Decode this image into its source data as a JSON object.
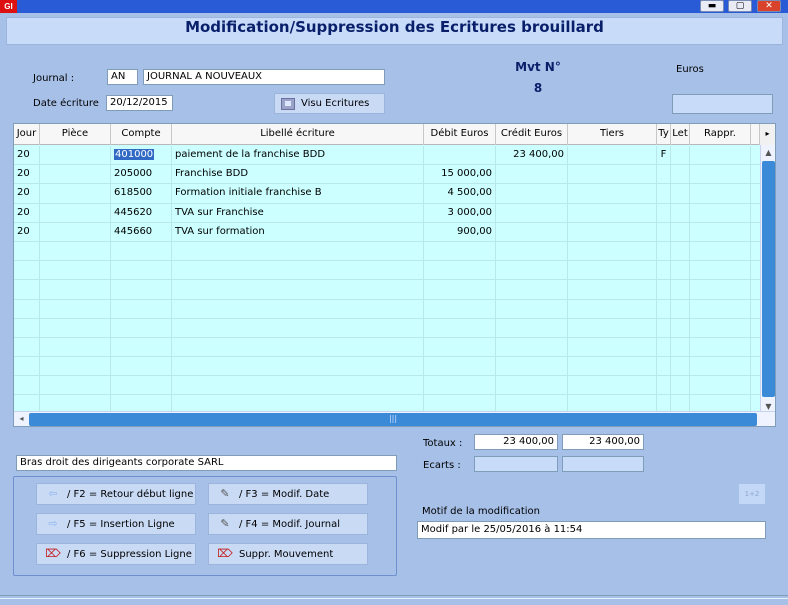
{
  "window": {
    "app_icon_text": "GI",
    "minimize_glyph": "▬",
    "maximize_glyph": "▢",
    "close_glyph": "✕"
  },
  "header": {
    "title": "Modification/Suppression des Ecritures brouillard"
  },
  "form": {
    "journal_label": "Journal :",
    "journal_code": "AN",
    "journal_name": "JOURNAL A NOUVEAUX",
    "date_label": "Date écriture",
    "date_value": "20/12/2015",
    "visu_button": "Visu Ecritures",
    "mvt_label": "Mvt N°",
    "mvt_number": "8",
    "currency_label": "Euros"
  },
  "grid": {
    "columns": [
      "Jour",
      "Pièce",
      "Compte",
      "Libellé écriture",
      "Débit Euros",
      "Crédit Euros",
      "Tiers",
      "Ty",
      "Let",
      "Rappr."
    ],
    "rows": [
      [
        "20",
        "",
        "401000",
        "paiement de la franchise BDD",
        "",
        "23 400,00",
        "",
        "F",
        "",
        ""
      ],
      [
        "20",
        "",
        "205000",
        "Franchise BDD",
        "15 000,00",
        "",
        "",
        "",
        "",
        ""
      ],
      [
        "20",
        "",
        "618500",
        "Formation initiale franchise B",
        "4 500,00",
        "",
        "",
        "",
        "",
        ""
      ],
      [
        "20",
        "",
        "445620",
        "TVA sur Franchise",
        "3 000,00",
        "",
        "",
        "",
        "",
        ""
      ],
      [
        "20",
        "",
        "445660",
        "TVA sur formation",
        "900,00",
        "",
        "",
        "",
        "",
        ""
      ]
    ],
    "empty_rows": 9,
    "scroll_right_glyph": "▸",
    "scroll_up_glyph": "▲",
    "scroll_down_glyph": "▼",
    "scroll_left_glyph": "◂",
    "hscroll_grip": "|||"
  },
  "totals": {
    "totaux_label": "Totaux :",
    "total_debit": "23 400,00",
    "total_credit": "23 400,00",
    "ecarts_label": "Ecarts :",
    "ecart_debit": "",
    "ecart_credit": ""
  },
  "account_desc": "Bras droit des dirigeants corporate SARL",
  "buttons": {
    "f2": "/ F2 = Retour début ligne",
    "f3": "/ F3 = Modif. Date",
    "f5": "/ F5 = Insertion Ligne",
    "f4": "/ F4 = Modif. Journal",
    "f6": "/ F6 = Suppression Ligne",
    "suppr": "Suppr. Mouvement",
    "plus_minus": "1+2"
  },
  "motif": {
    "label": "Motif de la modification",
    "value": "Modif par  le 25/05/2016 à 11:54"
  },
  "icons": {
    "arrow_left": "⇦",
    "arrow_right": "⇨",
    "pen": "✎",
    "eraser": "⌦"
  }
}
